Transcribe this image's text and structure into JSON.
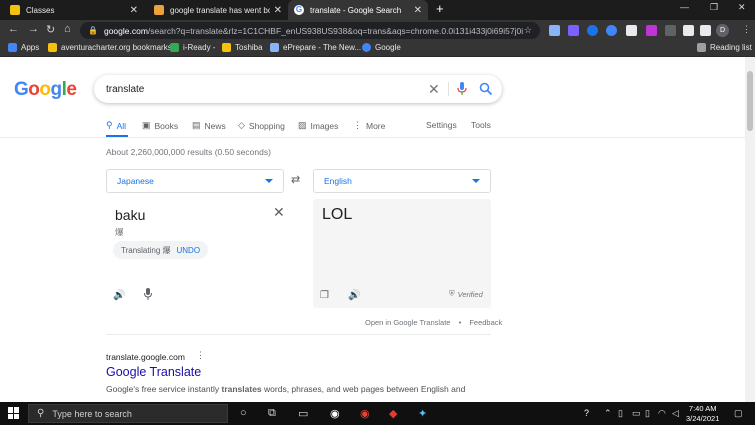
{
  "browser": {
    "tabs": [
      {
        "title": "Classes",
        "favicon_color": "#f4c20d"
      },
      {
        "title": "google translate has went bonkers",
        "favicon_color": "#e8a33c"
      },
      {
        "title": "translate - Google Search",
        "favicon_color": "#4285f4",
        "active": true
      }
    ],
    "url_domain": "google.com",
    "url_rest": "/search?q=translate&rlz=1C1CHBF_enUS938US938&oq=trans&aqs=chrome.0.0i131i433j0i69i57j0i1...",
    "profile_initial": "D",
    "bookmarks": [
      {
        "label": "Apps",
        "color": "#4285f4"
      },
      {
        "label": "aventuracharter.org bookmarks",
        "color": "#f4c20d"
      },
      {
        "label": "i-Ready -",
        "color": "#34a853"
      },
      {
        "label": "Toshiba",
        "color": "#f4c20d"
      },
      {
        "label": "ePrepare - The New...",
        "color": "#8ab4f8"
      },
      {
        "label": "Google",
        "color": "#4285f4"
      }
    ],
    "reading_list": "Reading list"
  },
  "google": {
    "logo_letters": [
      "G",
      "o",
      "o",
      "g",
      "l",
      "e"
    ],
    "logo_colors": [
      "#4285f4",
      "#ea4335",
      "#fbbc05",
      "#4285f4",
      "#34a853",
      "#ea4335"
    ],
    "query": "translate",
    "tabs": [
      "All",
      "Books",
      "News",
      "Shopping",
      "Images",
      "More"
    ],
    "tab_icons": [
      "search-icon",
      "book-icon",
      "news-icon",
      "tag-icon",
      "image-icon",
      "more-icon"
    ],
    "settings": "Settings",
    "tools": "Tools",
    "stats": "About 2,260,000,000 results (0.50 seconds)"
  },
  "translator": {
    "source_lang": "Japanese",
    "target_lang": "English",
    "source_text": "baku",
    "source_romaji": "爆",
    "translating_label": "Translating 爆",
    "undo": "UNDO",
    "target_text": "LOL",
    "verified": "Verified",
    "open_link": "Open in Google Translate",
    "feedback": "Feedback"
  },
  "result": {
    "url": "translate.google.com",
    "title": "Google Translate",
    "snippet_pre": "Google's free service instantly ",
    "snippet_bold": "translates",
    "snippet_post": " words, phrases, and web pages between English and"
  },
  "taskbar": {
    "search_placeholder": "Type here to search",
    "time": "7:40 AM",
    "date": "3/24/2021"
  }
}
